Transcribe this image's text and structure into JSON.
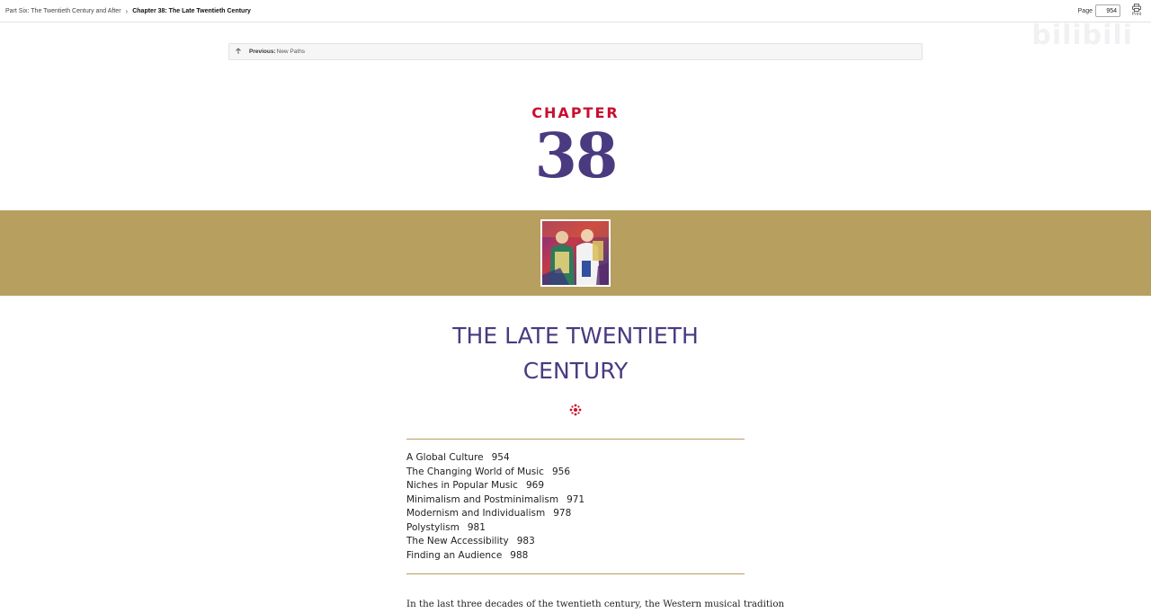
{
  "topbar": {
    "breadcrumb_parent": "Part Six: The Twentieth Century and After",
    "breadcrumb_separator": "›",
    "breadcrumb_current": "Chapter 38: The Late Twentieth Century",
    "page_label": "Page",
    "page_value": "954",
    "print_label": "Print"
  },
  "watermark": "bilibili",
  "previous": {
    "label": "Previous:",
    "title": "New Paths"
  },
  "chapter": {
    "word": "CHAPTER",
    "number": "38"
  },
  "title": {
    "line1": "THE LATE TWENTIETH",
    "line2": "CENTURY"
  },
  "toc": [
    {
      "label": "A Global Culture",
      "page": "954"
    },
    {
      "label": "The Changing World of Music",
      "page": "956"
    },
    {
      "label": "Niches in Popular Music",
      "page": "969"
    },
    {
      "label": "Minimalism and Postminimalism",
      "page": "971"
    },
    {
      "label": "Modernism and Individualism",
      "page": "978"
    },
    {
      "label": "Polystylism",
      "page": "981"
    },
    {
      "label": "The New Accessibility",
      "page": "983"
    },
    {
      "label": "Finding an Audience",
      "page": "988"
    }
  ],
  "body_text": "In the last three decades of the twentieth century, the Western musical tradition",
  "colors": {
    "accent_red": "#c8102e",
    "accent_purple": "#4a3a80",
    "band_gold": "#b69f5f"
  }
}
